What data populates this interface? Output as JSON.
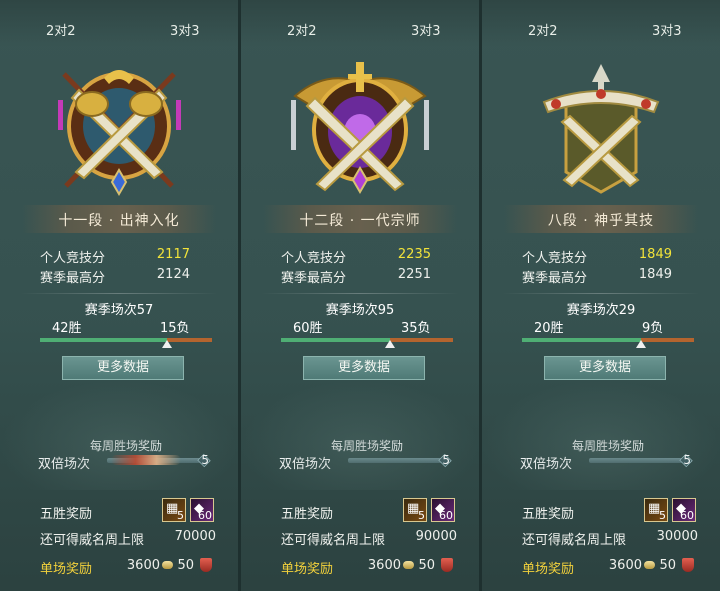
{
  "panels": [
    {
      "tabs": {
        "left": "2对2",
        "right": "3对3"
      },
      "rank": "十一段 · 出神入化",
      "emblem": "grandmaster-tier-emblem-icon",
      "stats": {
        "personal_label": "个人竞技分",
        "personal_value": "2117",
        "season_high_label": "赛季最高分",
        "season_high_value": "2124"
      },
      "season": {
        "label": "赛季场次57",
        "wins": "42胜",
        "losses": "15负",
        "win_ratio": 0.737
      },
      "more_button": "更多数据",
      "weekly": {
        "title": "每周胜场奖励",
        "double_label": "双倍场次",
        "double_count": "5",
        "flame": true
      },
      "rewards": {
        "five_win_label": "五胜奖励",
        "chest_count": "5",
        "gem_count": "60",
        "weekly_cap_label": "还可得威名周上限",
        "weekly_cap_value": "70000",
        "single_label": "单场奖励",
        "single_coin": "3600",
        "single_shield": "50"
      }
    },
    {
      "tabs": {
        "left": "2对2",
        "right": "3对3"
      },
      "rank": "十二段 · 一代宗师",
      "emblem": "supreme-tier-emblem-icon",
      "stats": {
        "personal_label": "个人竞技分",
        "personal_value": "2235",
        "season_high_label": "赛季最高分",
        "season_high_value": "2251"
      },
      "season": {
        "label": "赛季场次95",
        "wins": "60胜",
        "losses": "35负",
        "win_ratio": 0.632
      },
      "more_button": "更多数据",
      "weekly": {
        "title": "每周胜场奖励",
        "double_label": "双倍场次",
        "double_count": "5",
        "flame": false
      },
      "rewards": {
        "five_win_label": "五胜奖励",
        "chest_count": "5",
        "gem_count": "60",
        "weekly_cap_label": "还可得威名周上限",
        "weekly_cap_value": "90000",
        "single_label": "单场奖励",
        "single_coin": "3600",
        "single_shield": "50"
      }
    },
    {
      "tabs": {
        "left": "2对2",
        "right": "3对3"
      },
      "rank": "八段 · 神乎其技",
      "emblem": "gold-tier-emblem-icon",
      "stats": {
        "personal_label": "个人竞技分",
        "personal_value": "1849",
        "season_high_label": "赛季最高分",
        "season_high_value": "1849"
      },
      "season": {
        "label": "赛季场次29",
        "wins": "20胜",
        "losses": "9负",
        "win_ratio": 0.69
      },
      "more_button": "更多数据",
      "weekly": {
        "title": "每周胜场奖励",
        "double_label": "双倍场次",
        "double_count": "5",
        "flame": false
      },
      "rewards": {
        "five_win_label": "五胜奖励",
        "chest_count": "5",
        "gem_count": "60",
        "weekly_cap_label": "还可得威名周上限",
        "weekly_cap_value": "30000",
        "single_label": "单场奖励",
        "single_coin": "3600",
        "single_shield": "50"
      }
    }
  ],
  "colors": {
    "score_highlight": "#f2e33a",
    "single_reward_label": "#f2d13c",
    "win_bar": "#4fae74",
    "loss_bar": "#b4642e"
  }
}
